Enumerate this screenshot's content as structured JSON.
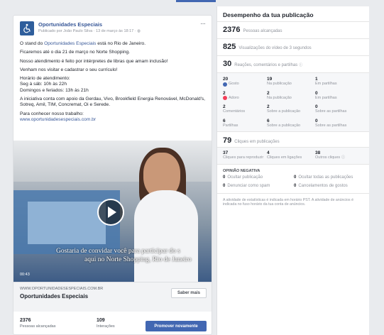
{
  "post": {
    "page_name": "Oportunidades Especiais",
    "meta": "Publicado por João Paulo Silva · 13 de março às 18:17 · ",
    "more": "···",
    "body": {
      "p1_before": "O stand do ",
      "p1_link": "Oportunidades Especiais",
      "p1_after": " está no Rio de Janeiro.",
      "p2": "Ficaremos até o dia 21 de março no Norte Shopping.",
      "p3": "Nosso atendimento é feito por intérpretes de libras que amam inclusão!",
      "p4": "Venham nos visitar e cadastrar o seu currículo!",
      "p5_l1": "Horário de atendimento:",
      "p5_l2": "Seg à sáb: 10h às 22h",
      "p5_l3": "Domingos e feriados: 13h às 21h",
      "p6": "A iniciativa conta com apoio da Gerdau, Vivo, Brookfield Energia Renovável, McDonald's, Sotreq, Amil, TIM, Concremat, Oi e Serede.",
      "p7_l1": "Para conhecer nosso trabalho:",
      "p7_link": "www.oportunidadesespeciais.com.br"
    },
    "video": {
      "caption_l1": "Gostaria de convidar você para participar do s",
      "caption_l2": "aqui no Norte Shopping, Rio de Janeiro",
      "duration": "00:43"
    },
    "link_preview": {
      "domain": "WWW.OPORTUNIDADESESPECIAIS.COM.BR",
      "title": "Oportunidades Especiais",
      "button": "Saber mais"
    },
    "stats": {
      "reach_num": "2376",
      "reach_lbl": "Pessoas alcançadas",
      "inter_num": "109",
      "inter_lbl": "Interações",
      "boost": "Promover novamente"
    }
  },
  "panel": {
    "title": "Desempenho da tua publicação",
    "reach": {
      "num": "2376",
      "lbl": "Pessoas alcançadas"
    },
    "views": {
      "num": "825",
      "lbl": "Visualizações do vídeo de 3 segundos"
    },
    "reactions": {
      "num": "30",
      "lbl": "Reações, comentários e partilhas"
    },
    "rgrid": [
      {
        "n": "20",
        "l": "Gosto",
        "icon": "like"
      },
      {
        "n": "19",
        "l": "Na publicação"
      },
      {
        "n": "1",
        "l": "Em partilhas"
      },
      {
        "n": "2",
        "l": "Adoro",
        "icon": "love"
      },
      {
        "n": "2",
        "l": "Na publicação"
      },
      {
        "n": "0",
        "l": "Em partilhas"
      },
      {
        "n": "2",
        "l": "Comentários"
      },
      {
        "n": "2",
        "l": "Sobre a publicação"
      },
      {
        "n": "0",
        "l": "Sobre as partilhas"
      },
      {
        "n": "6",
        "l": "Partilhas"
      },
      {
        "n": "6",
        "l": "Sobre a publicação"
      },
      {
        "n": "0",
        "l": "Sobre as partilhas"
      }
    ],
    "clicks": {
      "num": "79",
      "lbl": "Cliques em publicações"
    },
    "cgrid": [
      {
        "n": "37",
        "l": "Cliques para reproduzir"
      },
      {
        "n": "4",
        "l": "Cliques em ligações"
      },
      {
        "n": "38",
        "l": "Outros cliques"
      }
    ],
    "negative": {
      "title": "OPINIÃO NEGATIVA",
      "items": [
        {
          "n": "0",
          "l": "Ocultar publicação"
        },
        {
          "n": "0",
          "l": "Ocultar todas as publicações"
        },
        {
          "n": "0",
          "l": "Denunciar como spam"
        },
        {
          "n": "0",
          "l": "Cancelamentos de gostos"
        }
      ]
    },
    "footnote": "A atividade de estatísticas é indicada em horário PST. A atividade de anúncios é indicada no fuso horário da tua conta de anúncios."
  }
}
